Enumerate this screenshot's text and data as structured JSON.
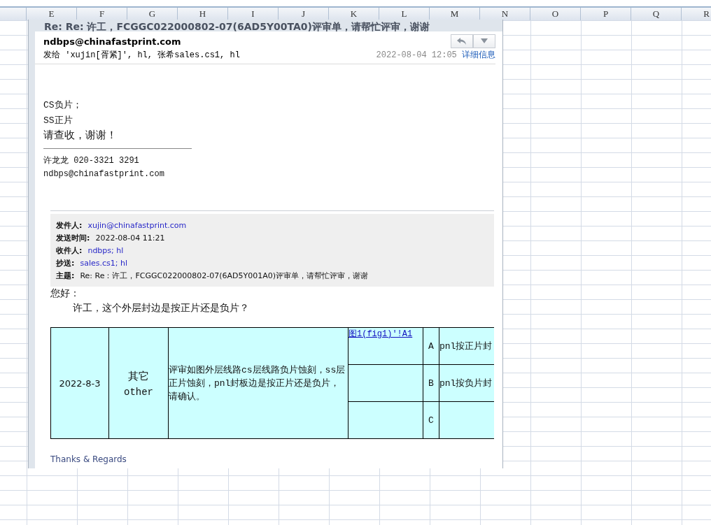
{
  "spreadsheet": {
    "columns": [
      "E",
      "F",
      "G",
      "H",
      "I",
      "J",
      "K",
      "L",
      "M",
      "N",
      "O",
      "P",
      "Q",
      "R"
    ]
  },
  "email": {
    "title": "Re: Re: 许工，FCGGC022000802-07(6AD5Y00TA0)评审单，请帮忙评审，谢谢",
    "sender": "ndbps@chinafastprint.com",
    "recipients": "发给 'xujin[胥紧]', hl, 张希sales.cs1, hl",
    "date": "2022-08-04 12:05",
    "details_link": "详细信息",
    "body_lines": [
      "CS负片；",
      "SS正片",
      "请查收，谢谢！"
    ],
    "signature": {
      "name_phone": "许龙龙  020-3321 3291",
      "email": "ndbps@chinafastprint.com"
    },
    "quoted_header": [
      {
        "label": "发件人:",
        "value": "xujin@chinafastprint.com",
        "kind": "link"
      },
      {
        "label": "发送时间:",
        "value": "2022-08-04 11:21",
        "kind": "text"
      },
      {
        "label": "收件人:",
        "value": "ndbps; hl",
        "kind": "link"
      },
      {
        "label": "抄送:",
        "value": "sales.cs1; hl",
        "kind": "link"
      },
      {
        "label": "主题:",
        "value": "Re: Re：许工，FCGGC022000802-07(6AD5Y001A0)评审单，请帮忙评审，谢谢",
        "kind": "text"
      }
    ],
    "greeting": "您好：",
    "question": "许工，这个外层封边是按正片还是负片？",
    "table": {
      "date": "2022-8-3",
      "category_zh": "其它",
      "category_en": "other",
      "description": "评审如图外层线路cs层线路负片蚀刻，ss层正片蚀刻，pnl封板边是按正片还是负片，请确认。",
      "link": "图1(fig1)'!A1",
      "options": [
        {
          "letter": "A",
          "text": "pnl按正片封"
        },
        {
          "letter": "B",
          "text": "pnl按负片封"
        },
        {
          "letter": "C"
        }
      ]
    },
    "closing": "Thanks & Regards"
  }
}
